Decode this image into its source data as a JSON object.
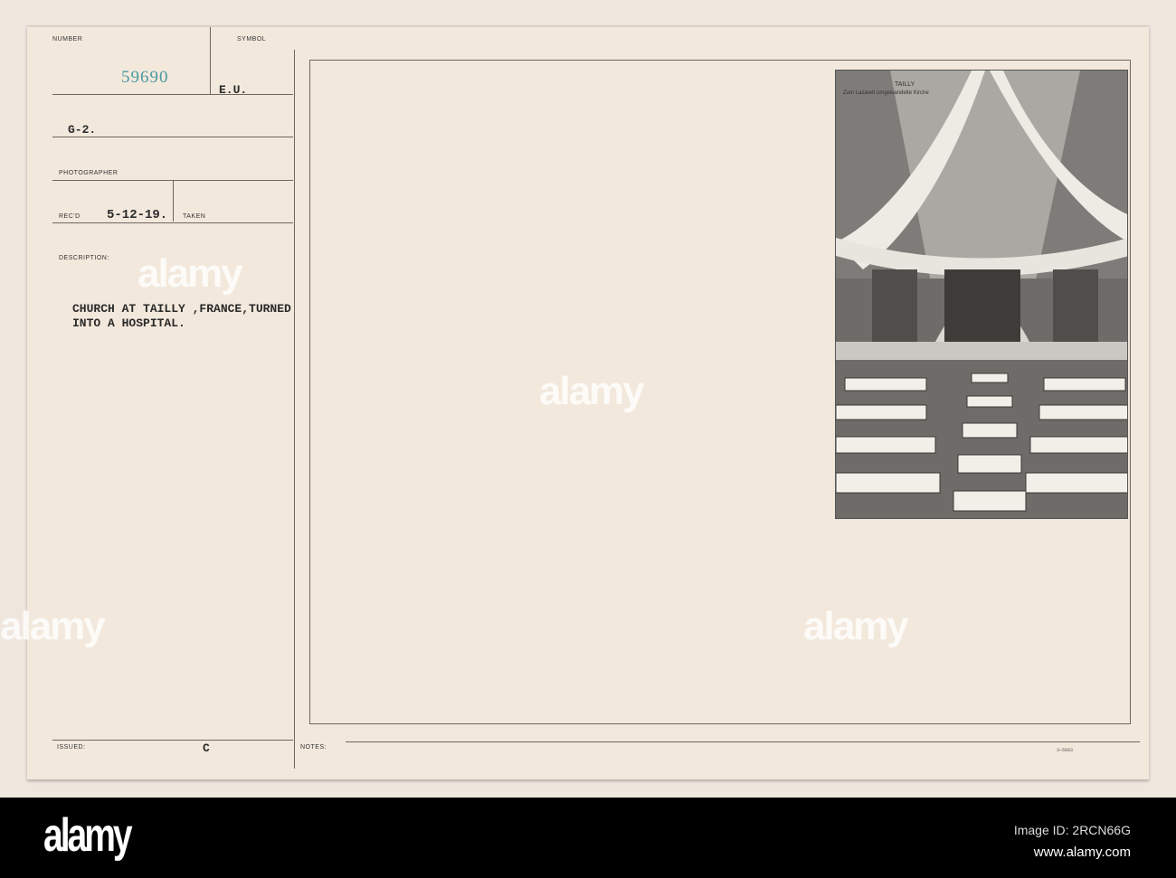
{
  "card": {
    "number_label": "NUMBER",
    "number": "59690",
    "symbol_label": "SYMBOL",
    "symbol": "E.U.",
    "section": "G-2.",
    "photographer_label": "PHOTOGRAPHER",
    "recd_label": "REC'D",
    "recd": "5-12-19.",
    "taken_label": "TAKEN",
    "description_label": "DESCRIPTION:",
    "description_line1": "CHURCH AT TAILLY ,FRANCE,TURNED",
    "description_line2": "INTO A HOSPITAL.",
    "issued_label": "ISSUED:",
    "issued": "C",
    "notes_label": "NOTES:",
    "form_number": "3—5603"
  },
  "photo": {
    "caption_title": "TAILLY",
    "caption_sub": "Zum Lazarett umgewandelte Kirche"
  },
  "watermark": {
    "text": "alamy",
    "letter": "a"
  },
  "footer": {
    "logo": "alamy",
    "image_id": "Image ID: 2RCN66G",
    "url": "www.alamy.com"
  },
  "colors": {
    "number": "#4a9aa0",
    "card": "#f3e8dc"
  }
}
